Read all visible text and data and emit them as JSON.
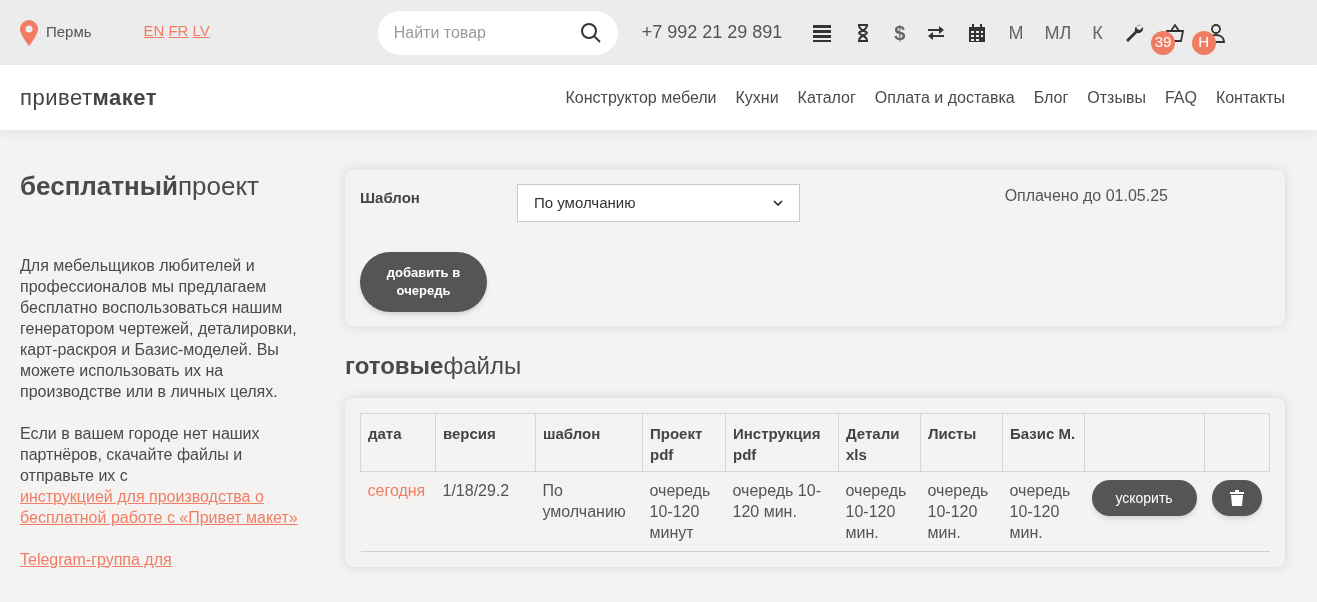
{
  "topbar": {
    "city": "Пермь",
    "languages": [
      {
        "label": "EN"
      },
      {
        "label": "FR"
      },
      {
        "label": "LV"
      }
    ],
    "search": {
      "placeholder": "Найти товар"
    },
    "phone": "+7 992 21 29 891",
    "tools": [
      {
        "kind": "icon"
      },
      {
        "kind": "icon"
      },
      {
        "kind": "text",
        "label": "$"
      },
      {
        "kind": "icon"
      },
      {
        "kind": "icon"
      },
      {
        "kind": "text",
        "label": "М"
      },
      {
        "kind": "text",
        "label": "МЛ"
      },
      {
        "kind": "text",
        "label": "К"
      },
      {
        "kind": "icon"
      },
      {
        "kind": "icon",
        "badge": "39"
      },
      {
        "kind": "icon",
        "badge": "Н"
      }
    ]
  },
  "navbar": {
    "logo_light": "привет",
    "logo_bold": "макет",
    "links": [
      "Конструктор мебели",
      "Кухни",
      "Каталог",
      "Оплата и доставка",
      "Блог",
      "Отзывы",
      "FAQ",
      "Контакты"
    ]
  },
  "sidebar": {
    "title_bold": "бесплатный",
    "title_light": "проект",
    "paragraphs": [
      {
        "text": "Для мебельщиков любителей и профессионалов мы предлагаем бесплатно воспользоваться нашим генератором чертежей, деталировки, карт-раскроя и Базис-моделей. Вы можете использовать их на производстве или в личных целях."
      },
      {
        "text": "Если в вашем городе нет наших партнёров, скачайте файлы и отправьте их с ",
        "link": "инструкцией для производства о бесплатной работе с «Привет макет»"
      },
      {
        "link": "Telegram-группа для"
      }
    ]
  },
  "template_card": {
    "label": "Шаблон",
    "select_value": "По умолчанию",
    "paid_until": "Оплачено до 01.05.25",
    "button": "добавить в очередь"
  },
  "files": {
    "title_bold": "готовые",
    "title_light": "файлы",
    "columns": [
      "дата",
      "версия",
      "шаблон",
      "Проект pdf",
      "Инструкция pdf",
      "Детали xls",
      "Листы",
      "Базис М."
    ],
    "rows": [
      {
        "cells": [
          "сегодня",
          "1/18/29.2",
          "По умолчанию",
          "очередь 10-120 минут",
          "очередь 10-120 мин.",
          "очередь 10-120 мин.",
          "очередь 10-120 мин.",
          "очередь 10-120 мин."
        ],
        "action": "ускорить"
      }
    ]
  }
}
